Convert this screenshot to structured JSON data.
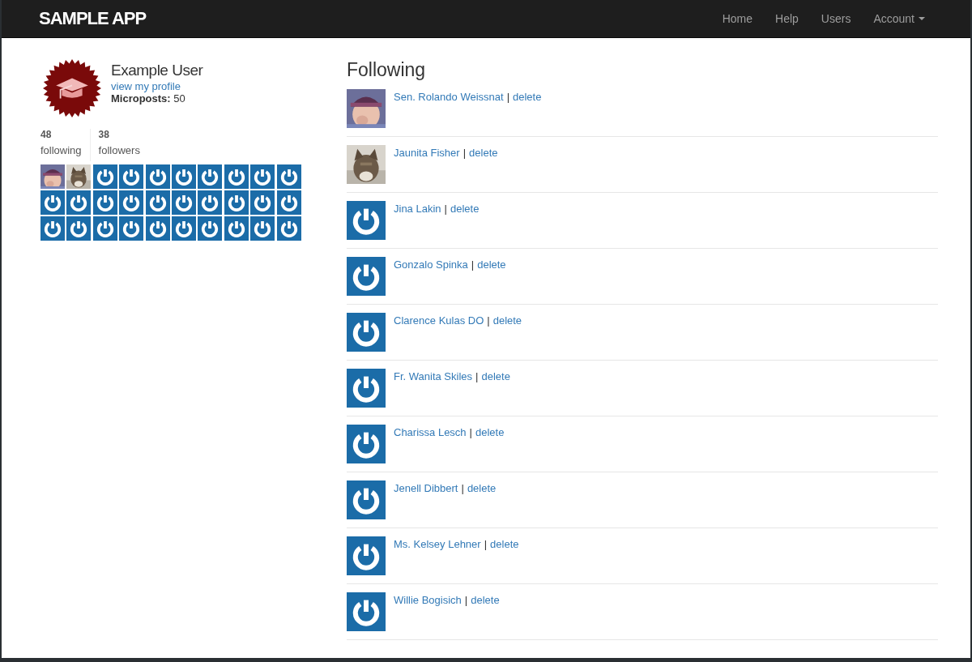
{
  "navbar": {
    "logo": "SAMPLE APP",
    "links": [
      {
        "label": "Home",
        "kind": "link"
      },
      {
        "label": "Help",
        "kind": "link"
      },
      {
        "label": "Users",
        "kind": "link"
      },
      {
        "label": "Account",
        "kind": "dropdown"
      }
    ]
  },
  "profile": {
    "name": "Example User",
    "profile_link": "view my profile",
    "microposts_label": "Microposts:",
    "microposts_count": "50"
  },
  "stats": [
    {
      "count": "48",
      "label": "following"
    },
    {
      "count": "38",
      "label": "followers"
    }
  ],
  "avatar_grid": [
    {
      "kind": "picture"
    },
    {
      "kind": "picture"
    },
    {
      "kind": "gravatar"
    },
    {
      "kind": "gravatar"
    },
    {
      "kind": "gravatar"
    },
    {
      "kind": "gravatar"
    },
    {
      "kind": "gravatar"
    },
    {
      "kind": "gravatar"
    },
    {
      "kind": "gravatar"
    },
    {
      "kind": "gravatar"
    },
    {
      "kind": "gravatar"
    },
    {
      "kind": "gravatar"
    },
    {
      "kind": "gravatar"
    },
    {
      "kind": "gravatar"
    },
    {
      "kind": "gravatar"
    },
    {
      "kind": "gravatar"
    },
    {
      "kind": "gravatar"
    },
    {
      "kind": "gravatar"
    },
    {
      "kind": "gravatar"
    },
    {
      "kind": "gravatar"
    },
    {
      "kind": "gravatar"
    },
    {
      "kind": "gravatar"
    },
    {
      "kind": "gravatar"
    },
    {
      "kind": "gravatar"
    },
    {
      "kind": "gravatar"
    },
    {
      "kind": "gravatar"
    },
    {
      "kind": "gravatar"
    },
    {
      "kind": "gravatar"
    },
    {
      "kind": "gravatar"
    },
    {
      "kind": "gravatar"
    }
  ],
  "heading": "Following",
  "users": [
    {
      "name": "Sen. Rolando Weissnat",
      "separator": "|",
      "action": "delete",
      "kind": "picture"
    },
    {
      "name": "Jaunita Fisher",
      "separator": "|",
      "action": "delete",
      "kind": "picture"
    },
    {
      "name": "Jina Lakin",
      "separator": "|",
      "action": "delete",
      "kind": "gravatar"
    },
    {
      "name": "Gonzalo Spinka",
      "separator": "|",
      "action": "delete",
      "kind": "gravatar"
    },
    {
      "name": "Clarence Kulas DO",
      "separator": "|",
      "action": "delete",
      "kind": "gravatar"
    },
    {
      "name": "Fr. Wanita Skiles",
      "separator": "|",
      "action": "delete",
      "kind": "gravatar"
    },
    {
      "name": "Charissa Lesch",
      "separator": "|",
      "action": "delete",
      "kind": "gravatar"
    },
    {
      "name": "Jenell Dibbert",
      "separator": "|",
      "action": "delete",
      "kind": "gravatar"
    },
    {
      "name": "Ms. Kelsey Lehner",
      "separator": "|",
      "action": "delete",
      "kind": "gravatar"
    },
    {
      "name": "Willie Bogisich",
      "separator": "|",
      "action": "delete",
      "kind": "gravatar"
    }
  ]
}
